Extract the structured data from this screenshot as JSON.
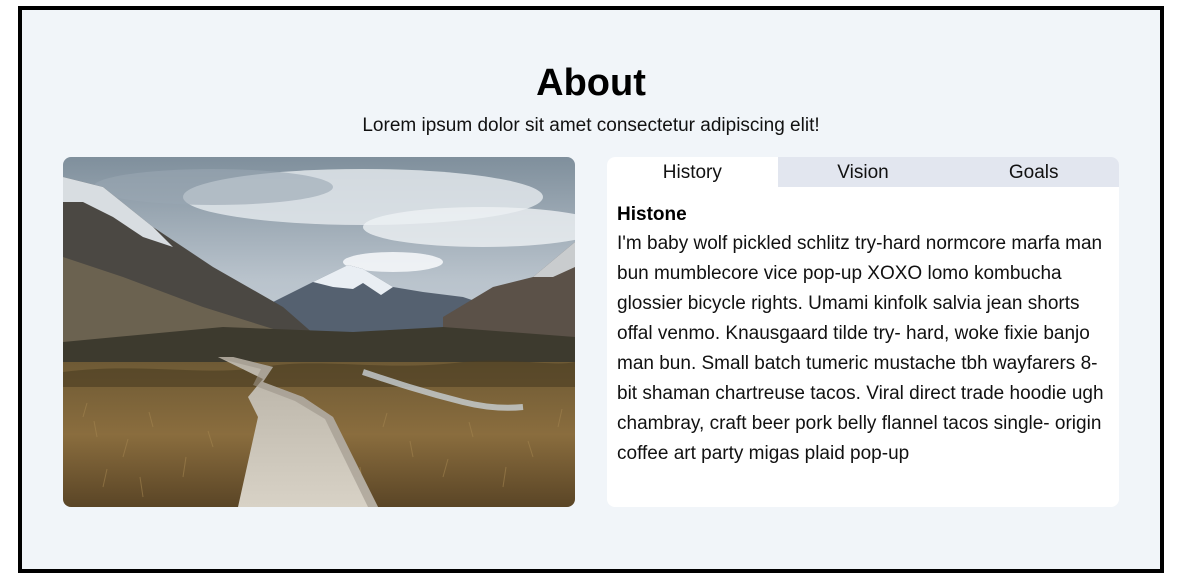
{
  "section": {
    "title": "About",
    "subtitle": "Lorem ipsum dolor sit amet consectetur adipiscing elit!"
  },
  "image": {
    "alt": "Mountain valley with wooden boardwalk"
  },
  "tabs": [
    {
      "label": "History",
      "active": true
    },
    {
      "label": "Vision",
      "active": false
    },
    {
      "label": "Goals",
      "active": false
    }
  ],
  "panel": {
    "heading": "Histone",
    "body": "I'm baby wolf pickled schlitz try-hard normcore marfa man bun mumblecore vice pop-up XOXO lomo kombucha glossier bicycle rights. Umami kinfolk salvia jean shorts offal venmo. Knausgaard tilde try- hard, woke fixie banjo man bun. Small batch tumeric mustache tbh wayfarers 8-bit shaman chartreuse tacos. Viral direct trade hoodie ugh chambray, craft beer pork belly flannel tacos single- origin coffee art party migas plaid pop-up"
  },
  "colors": {
    "background": "#f1f5f9",
    "border": "#000000",
    "tab_inactive": "#e2e6ef",
    "tab_active": "#ffffff"
  }
}
